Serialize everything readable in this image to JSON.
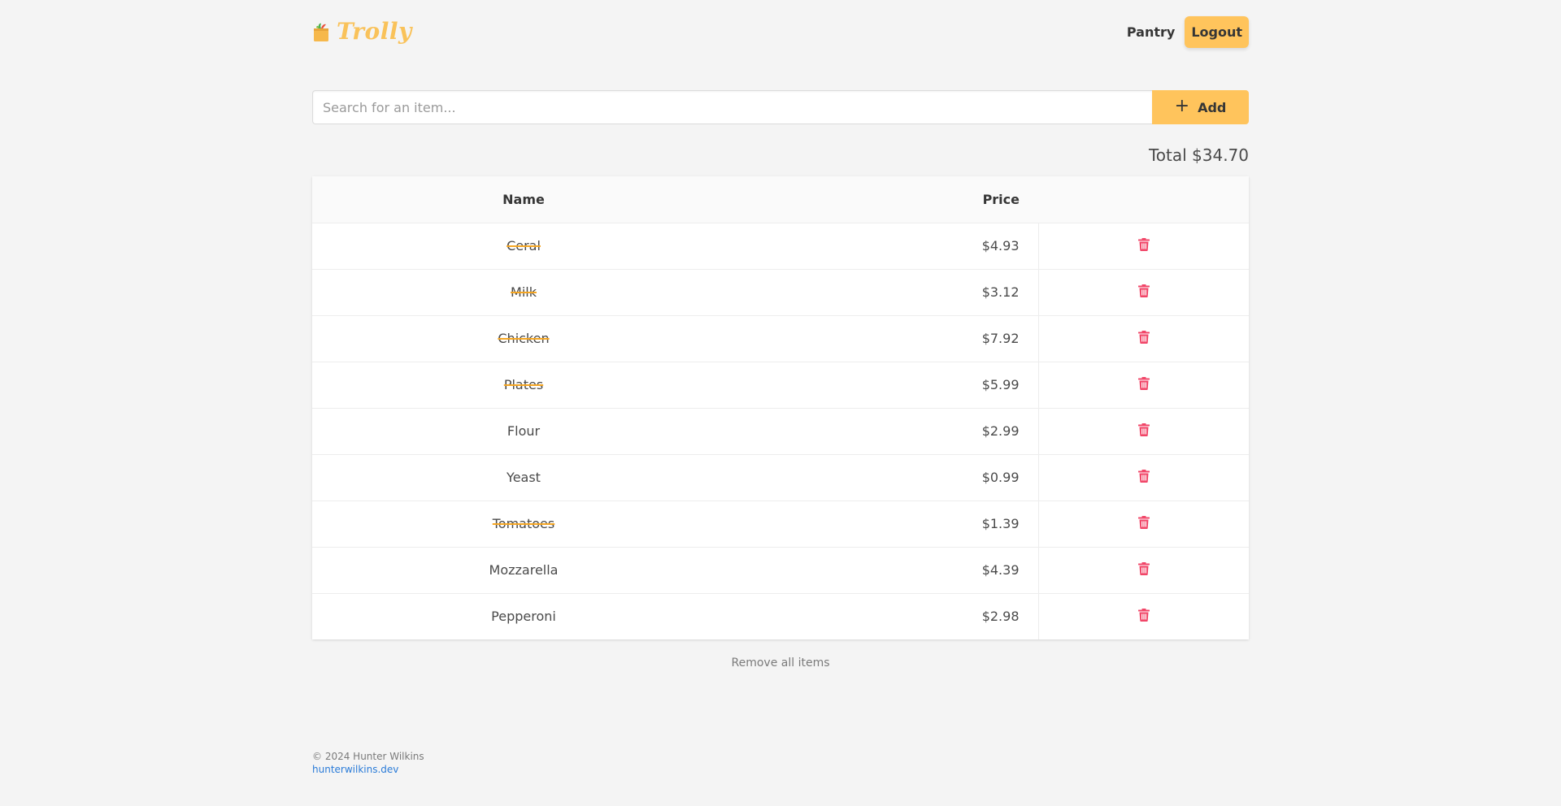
{
  "brand": {
    "name": "Trolly",
    "icon": "grocery-bag-icon"
  },
  "nav": {
    "pantry_label": "Pantry",
    "logout_label": "Logout"
  },
  "search": {
    "placeholder": "Search for an item...",
    "value": "",
    "add_label": "Add",
    "add_icon": "plus-icon"
  },
  "total": {
    "text": "Total $34.70"
  },
  "table": {
    "columns": {
      "name": "Name",
      "price": "Price"
    },
    "rows": [
      {
        "name": "Ceral",
        "price": "$4.93",
        "crossed": true
      },
      {
        "name": "Milk",
        "price": "$3.12",
        "crossed": true
      },
      {
        "name": "Chicken",
        "price": "$7.92",
        "crossed": true
      },
      {
        "name": "Plates",
        "price": "$5.99",
        "crossed": true
      },
      {
        "name": "Flour",
        "price": "$2.99",
        "crossed": false
      },
      {
        "name": "Yeast",
        "price": "$0.99",
        "crossed": false
      },
      {
        "name": "Tomatoes",
        "price": "$1.39",
        "crossed": true
      },
      {
        "name": "Mozzarella",
        "price": "$4.39",
        "crossed": false
      },
      {
        "name": "Pepperoni",
        "price": "$2.98",
        "crossed": false
      }
    ],
    "delete_icon": "trash-icon"
  },
  "remove_all_label": "Remove all items",
  "footer": {
    "copyright": "© 2024 Hunter Wilkins",
    "link": "hunterwilkins.dev"
  },
  "colors": {
    "accent": "#ffc45c",
    "brand": "#f9c25a",
    "danger": "#f14668",
    "strike": "#f5a623",
    "link": "#2a7bd8"
  }
}
